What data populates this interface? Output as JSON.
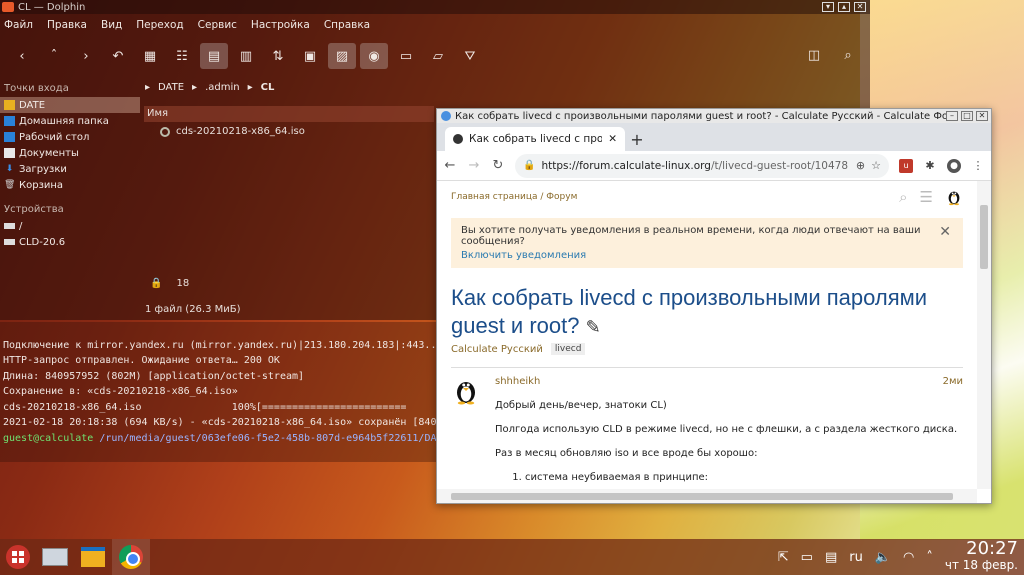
{
  "dolphin": {
    "title": "CL — Dolphin",
    "menu": [
      "Файл",
      "Правка",
      "Вид",
      "Переход",
      "Сервис",
      "Настройка",
      "Справка"
    ],
    "places_header": "Точки входа",
    "places": [
      {
        "label": "DATE",
        "icon": "folder-icon",
        "selected": true
      },
      {
        "label": "Домашняя папка",
        "icon": "home-icon"
      },
      {
        "label": "Рабочий стол",
        "icon": "desktop-icon"
      },
      {
        "label": "Документы",
        "icon": "documents-icon"
      },
      {
        "label": "Загрузки",
        "icon": "downloads-icon"
      },
      {
        "label": "Корзина",
        "icon": "trash-icon"
      }
    ],
    "devices_header": "Устройства",
    "devices": [
      {
        "label": "/",
        "icon": "drive-icon"
      },
      {
        "label": "CLD-20.6",
        "icon": "drive-icon"
      }
    ],
    "breadcrumb": [
      "DATE",
      ".admin",
      "CL"
    ],
    "column_name": "Имя",
    "file": "cds-20210218-x86_64.iso",
    "lock_count": "18",
    "status": "1 файл (26.3 МиБ)"
  },
  "terminal": {
    "lines": [
      "Подключение к mirror.yandex.ru (mirror.yandex.ru)|213.180.204.183|:443...",
      "HTTP-запрос отправлен. Ожидание ответа… 200 OK",
      "Длина: 840957952 (802M) [application/octet-stream]",
      "Сохранение в: «cds-20210218-x86_64.iso»",
      "",
      "cds-20210218-x86_64.iso               100%[========================",
      "",
      "2021-02-18 20:18:38 (694 KB/s) - «cds-20210218-x86_64.iso» сохранён [840"
    ],
    "prompt_user": "guest@calculate",
    "prompt_path": " /run/media/guest/063efe06-f5e2-458b-807d-e964b5f22611/DA"
  },
  "chrome": {
    "window_title": "Как собрать livecd с произвольными паролями guest и root? - Calculate Русский - Calculate Форум",
    "tab_label": "Как собрать livecd с произвол",
    "url_host": "https://forum.calculate-linux.org",
    "url_path": "/t/livecd-guest-root/10478",
    "breadcrumb": "Главная страница / Форум",
    "notice_text": "Вы хотите получать уведомления в реальном времени, когда люди отвечают на ваши сообщения?",
    "notice_link": "Включить уведомления",
    "topic_title": "Как собрать livecd с произвольными паролями guest и root?",
    "category": "Calculate Русский",
    "tag": "livecd",
    "post": {
      "user": "shhheikh",
      "time": "2ми",
      "p1": "Добрый день/вечер, знатоки CL)",
      "p2": "Полгода использую CLD в режиме livecd, но не с флешки, а с раздела жесткого диска.",
      "p3": "Раз в месяц обновляю iso и все вроде бы хорошо:",
      "li1": "система неубиваемая в принципе:"
    }
  },
  "tray": {
    "lang": "ru",
    "time": "20:27",
    "date": "чт 18 февр."
  }
}
